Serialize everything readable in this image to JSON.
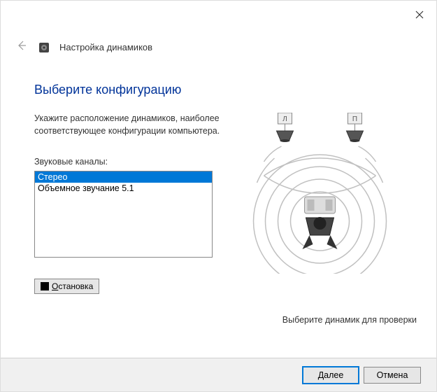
{
  "header": {
    "title": "Настройка динамиков"
  },
  "main": {
    "title": "Выберите конфигурацию",
    "description": "Укажите расположение динамиков, наиболее соответствующее конфигурации компьютера.",
    "list_label": "Звуковые каналы:",
    "channels": {
      "item0": "Стерео",
      "item1": "Объемное звучание 5.1"
    },
    "stop_btn_prefix": "О",
    "stop_btn_rest": "становка",
    "instruction": "Выберите динамик для проверки",
    "diagram_labels": {
      "left": "Л",
      "right": "П"
    }
  },
  "footer": {
    "next_prefix": "Д",
    "next_rest": "алее",
    "cancel": "Отмена"
  }
}
